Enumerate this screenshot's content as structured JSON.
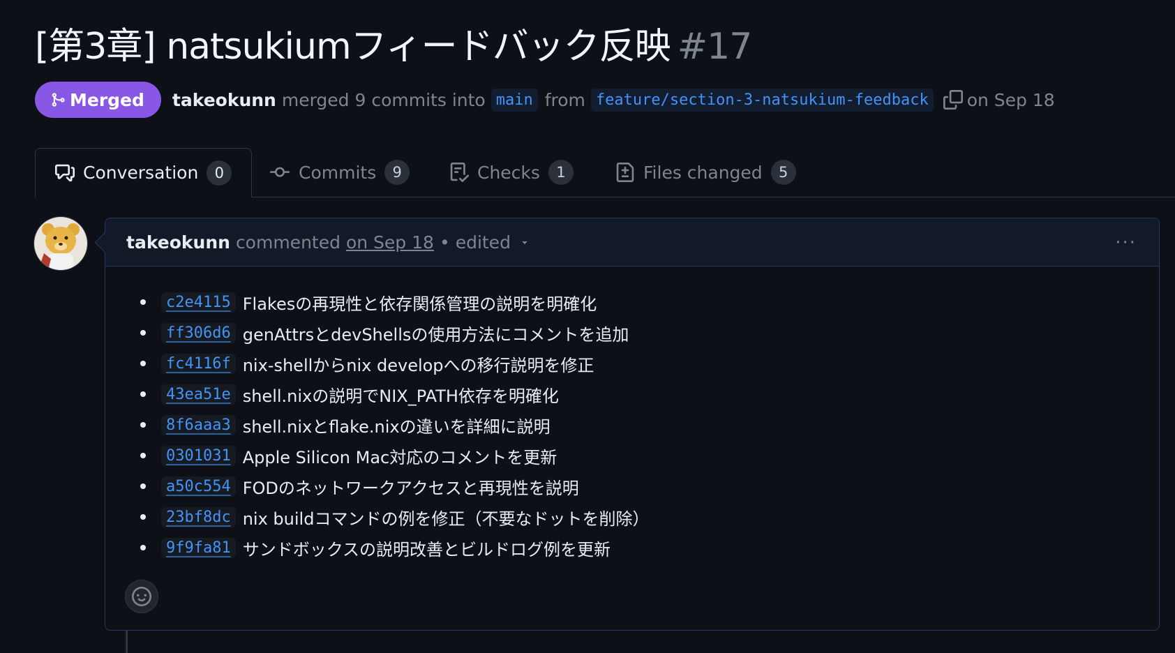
{
  "pr": {
    "title": "[第3章] natsukiumフィードバック反映",
    "number": "#17",
    "status_label": "Merged",
    "author": "takeokunn",
    "merged_text": "merged 9 commits into",
    "base_branch": "main",
    "from_text": "from",
    "head_branch": "feature/section-3-natsukium-feedback",
    "date_text": "on Sep 18"
  },
  "tabs": [
    {
      "label": "Conversation",
      "count": "0",
      "icon": "comment-discussion-icon"
    },
    {
      "label": "Commits",
      "count": "9",
      "icon": "git-commit-icon"
    },
    {
      "label": "Checks",
      "count": "1",
      "icon": "checklist-icon"
    },
    {
      "label": "Files changed",
      "count": "5",
      "icon": "file-diff-icon"
    }
  ],
  "comment": {
    "author": "takeokunn",
    "action": "commented",
    "date": "on Sep 18",
    "separator": "•",
    "edited": "edited",
    "menu": "···",
    "commits": [
      {
        "sha": "c2e4115",
        "message": "Flakesの再現性と依存関係管理の説明を明確化"
      },
      {
        "sha": "ff306d6",
        "message": "genAttrsとdevShellsの使用方法にコメントを追加"
      },
      {
        "sha": "fc4116f",
        "message": "nix-shellからnix developへの移行説明を修正"
      },
      {
        "sha": "43ea51e",
        "message": "shell.nixの説明でNIX_PATH依存を明確化"
      },
      {
        "sha": "8f6aaa3",
        "message": "shell.nixとflake.nixの違いを詳細に説明"
      },
      {
        "sha": "0301031",
        "message": "Apple Silicon Mac対応のコメントを更新"
      },
      {
        "sha": "a50c554",
        "message": "FODのネットワークアクセスと再現性を説明"
      },
      {
        "sha": "23bf8dc",
        "message": "nix buildコマンドの例を修正（不要なドットを削除）"
      },
      {
        "sha": "9f9fa81",
        "message": "サンドボックスの説明改善とビルドログ例を更新"
      }
    ]
  },
  "colors": {
    "merged": "#8957e5",
    "link": "#4493f8",
    "background": "#0d1117"
  }
}
